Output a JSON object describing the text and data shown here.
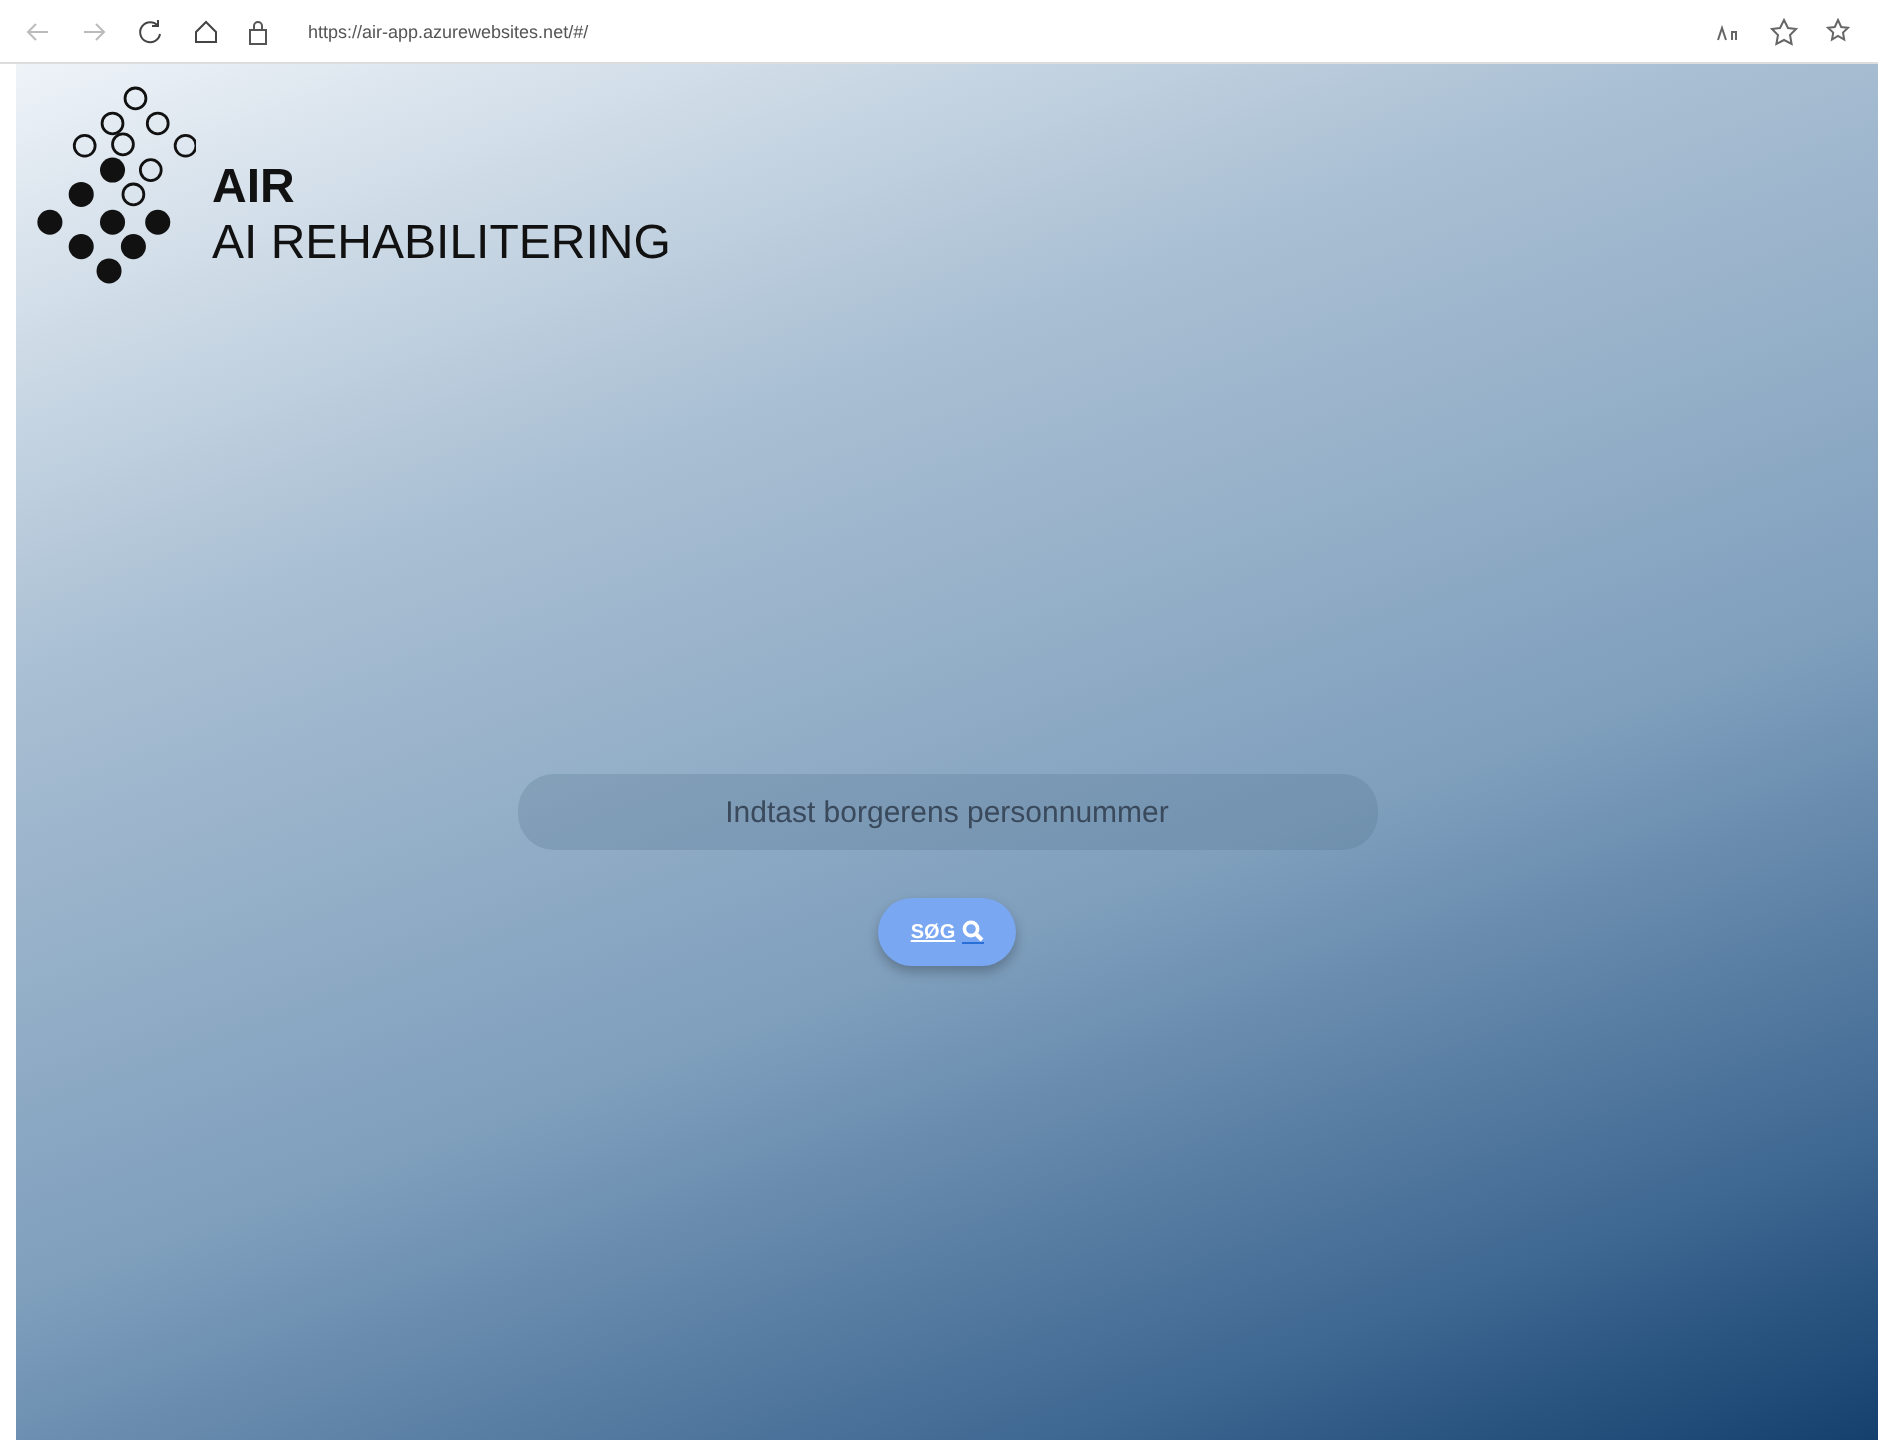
{
  "browser": {
    "url": "https://air-app.azurewebsites.net/#/"
  },
  "header": {
    "title": "AIR",
    "subtitle": "AI REHABILITERING"
  },
  "search": {
    "placeholder": "Indtast borgerens personnummer"
  },
  "button": {
    "label": "SØG"
  }
}
